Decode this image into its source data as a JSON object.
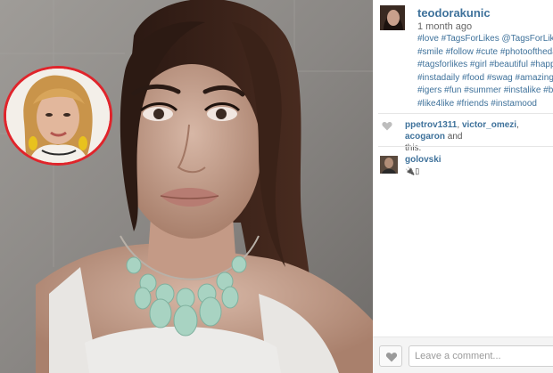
{
  "post": {
    "username": "teodorakunic",
    "time_ago": "1 month ago",
    "caption_lines": [
      "#love #TagsForLikes @TagsForLikes #",
      "#smile #follow #cute #photooftheday",
      "#tagsforlikes #girl #beautiful #happy #",
      "#instadaily #food #swag #amazing #T",
      "#igers #fun #summer #instalike #best",
      "#like4like #friends #instamood"
    ]
  },
  "likes": {
    "names": [
      "ppetrov1311",
      "victor_omezi",
      "acogaron"
    ],
    "suffix_1": ", ",
    "suffix_2": " and",
    "trailing": "this."
  },
  "comment": {
    "username": "golovski",
    "text": "🔌▯"
  },
  "comment_box": {
    "placeholder": "Leave a comment..."
  },
  "icons": {
    "like": "heart-icon",
    "likes_count": "heart-outline-icon"
  },
  "colors": {
    "link": "#3f729b",
    "inset_ring": "#e0242b",
    "bar_background": "#f4f4f4"
  }
}
